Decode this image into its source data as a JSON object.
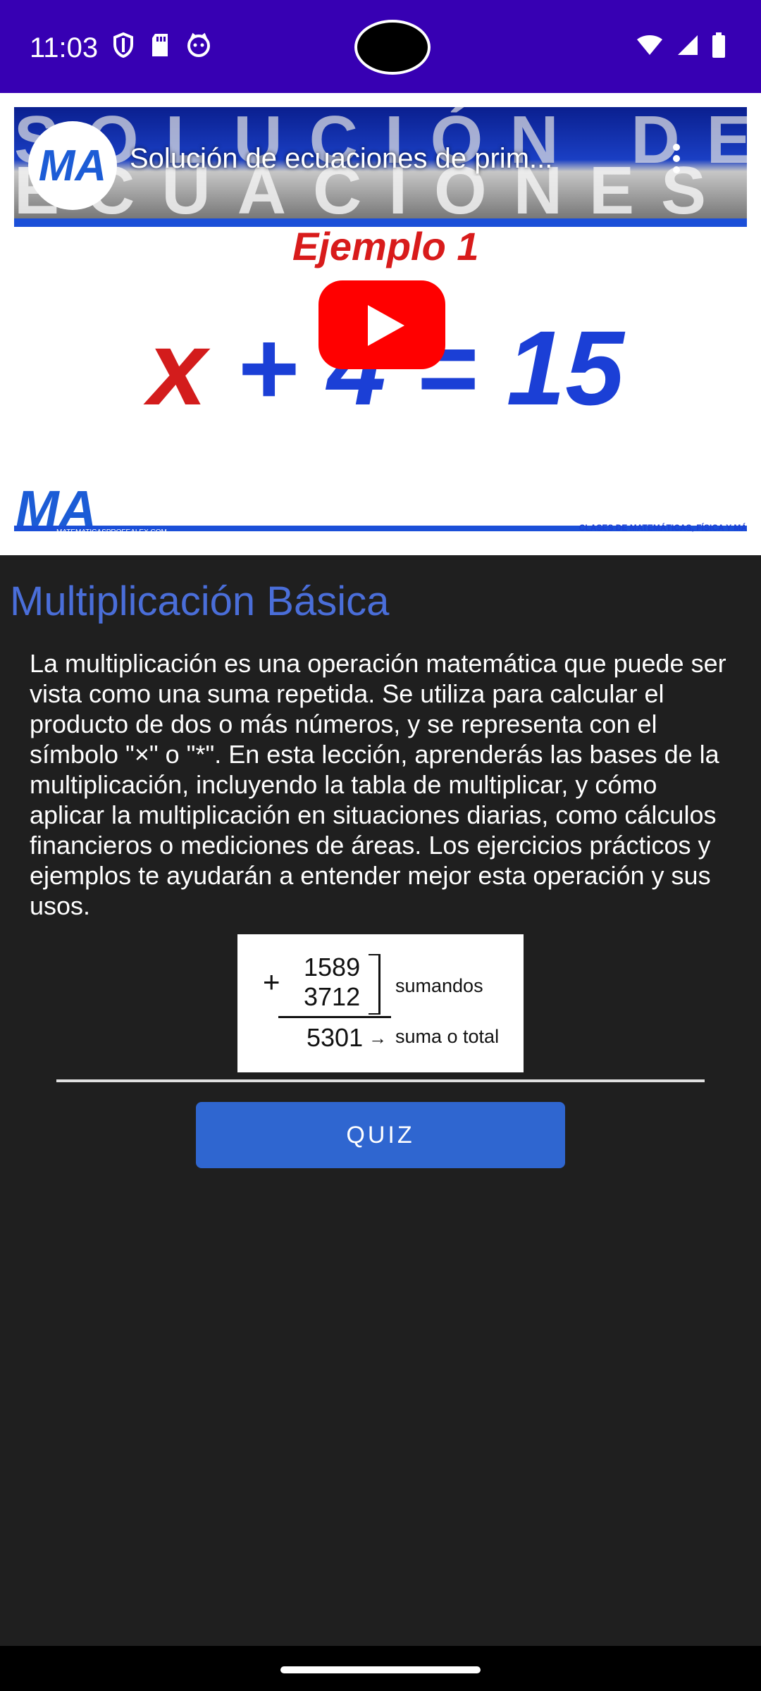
{
  "status_bar": {
    "time": "11:03",
    "left_icons": [
      "shield-icon",
      "sd-card-icon",
      "cat-icon"
    ],
    "right_icons": [
      "wifi-icon",
      "signal-icon",
      "battery-icon"
    ],
    "background": "#3700b3"
  },
  "video": {
    "title": "Solución de ecuaciones de prim...",
    "channel_logo_text": "MA",
    "banner_line1": "SOLUCIÓN DE",
    "banner_line2": "ECUACIONES",
    "example_label": "Ejemplo 1",
    "equation_x": "x",
    "equation_rest": " + 4 = 15",
    "footer_logo_text": "MA",
    "footer_url": "MATEMATICASPROFEALEX.COM",
    "footer_right": "CLASES DE MATEMÁTICAS, FÍSICA Y MÁ"
  },
  "lesson": {
    "title": "Multiplicación Básica",
    "body": "La multiplicación es una operación matemática que puede ser vista como una suma repetida. Se utiliza para calcular el producto de dos o más números, y se representa con el símbolo \"×\" o \"*\". En esta lección, aprenderás las bases de la multiplicación, incluyendo la tabla de multiplicar, y cómo aplicar la multiplicación en situaciones diarias, como cálculos financieros o mediciones de áreas. Los ejercicios prácticos y ejemplos te ayudarán a entender mejor esta operación y sus usos.",
    "title_color": "#4a6ed9"
  },
  "sum_image": {
    "plus": "+",
    "addend1": "1589",
    "addend2": "3712",
    "addends_label": "sumandos",
    "total": "5301",
    "arrow": "→",
    "total_label": "suma o total"
  },
  "quiz": {
    "label": "QUIZ",
    "color": "#2f66d0"
  }
}
